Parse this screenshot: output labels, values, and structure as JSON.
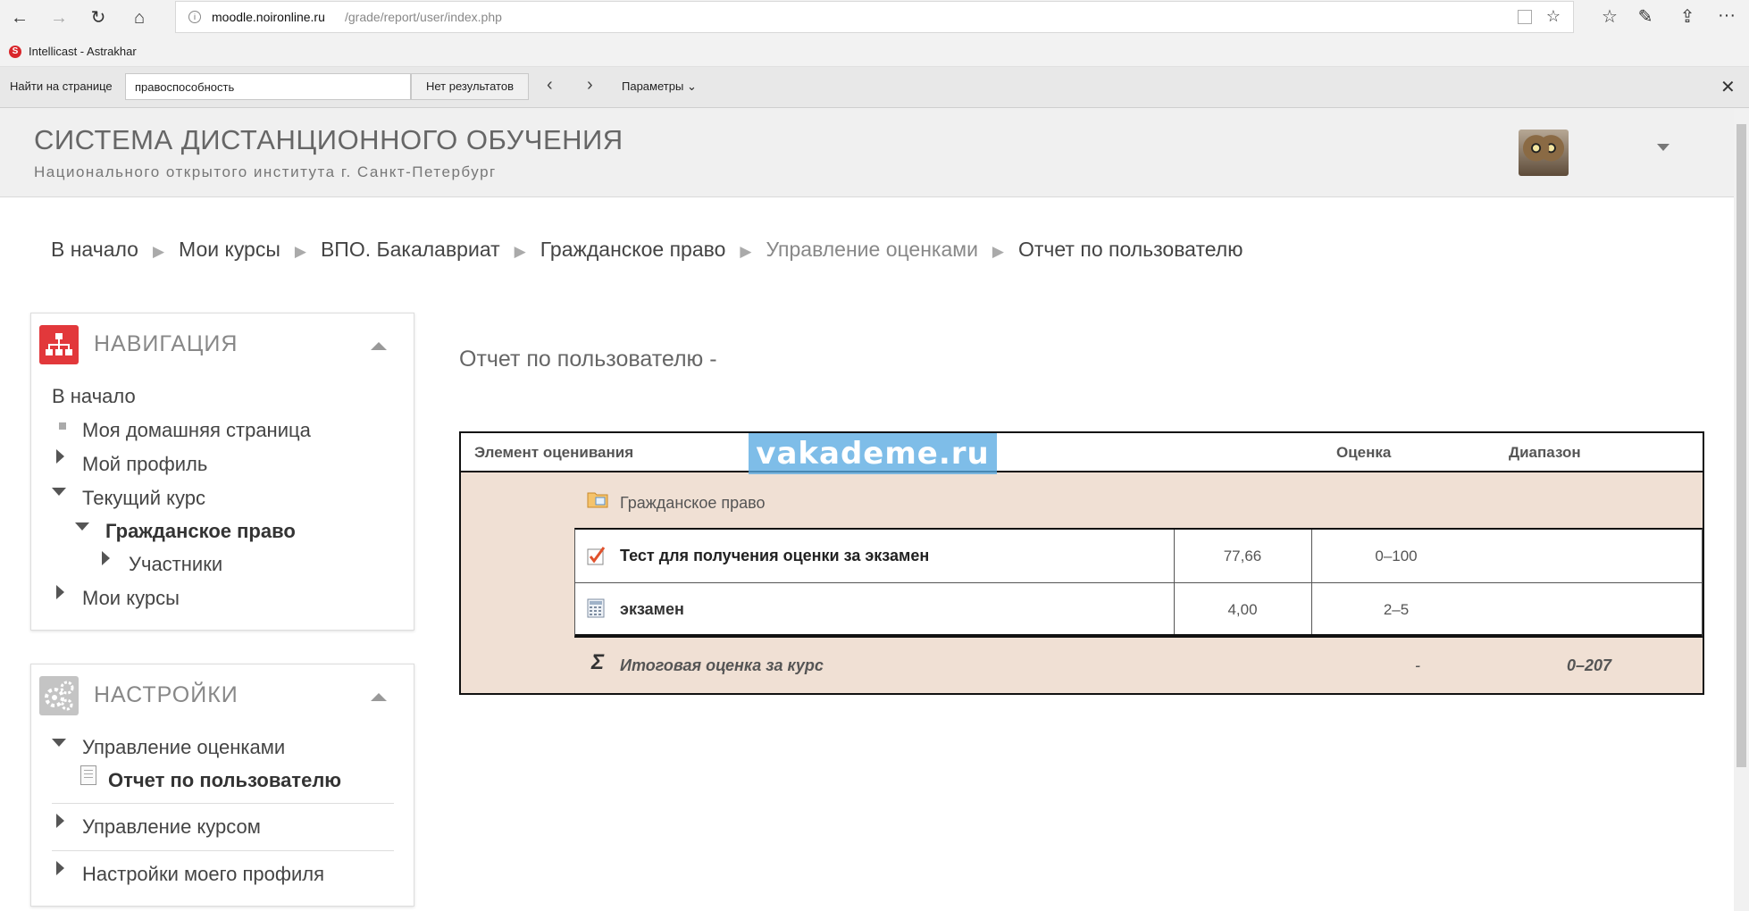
{
  "browser": {
    "url_host": "moodle.noironline.ru",
    "url_path": "/grade/report/user/index.php",
    "favorites": [
      {
        "label": "Intellicast - Astrakhar"
      }
    ],
    "find": {
      "label": "Найти на странице",
      "query": "правоспособность",
      "results": "Нет результатов",
      "options": "Параметры"
    }
  },
  "site": {
    "title": "СИСТЕМА ДИСТАНЦИОННОГО ОБУЧЕНИЯ",
    "subtitle": "Национального открытого института г. Санкт-Петербург"
  },
  "breadcrumb": [
    "В начало",
    "Мои курсы",
    "ВПО. Бакалавриат",
    "Гражданское право",
    "Управление оценками",
    "Отчет по пользователю"
  ],
  "navigation": {
    "title": "НАВИГАЦИЯ",
    "items": {
      "home": "В начало",
      "dashboard": "Моя домашняя страница",
      "profile": "Мой профиль",
      "current_course": "Текущий курс",
      "course": "Гражданское право",
      "participants": "Участники",
      "my_courses": "Мои курсы"
    }
  },
  "settings": {
    "title": "НАСТРОЙКИ",
    "items": {
      "grade_admin": "Управление оценками",
      "user_report": "Отчет по пользователю",
      "course_admin": "Управление курсом",
      "profile_settings": "Настройки моего профиля"
    }
  },
  "main": {
    "heading": "Отчет по пользователю -",
    "table": {
      "headers": {
        "item": "Элемент оценивания",
        "grade": "Оценка",
        "range": "Диапазон"
      },
      "category": "Гражданское право",
      "rows": [
        {
          "name": "Тест для получения оценки за экзамен",
          "grade": "77,66",
          "range": "0–100",
          "icon": "quiz-icon"
        },
        {
          "name": "экзамен",
          "grade": "4,00",
          "range": "2–5",
          "icon": "calculator-icon"
        }
      ],
      "total": {
        "name": "Итоговая оценка за курс",
        "grade": "-",
        "range": "0–207"
      }
    }
  },
  "watermark": "vakademe.ru",
  "colors": {
    "category_bg": "#f0e0d4",
    "nav_icon": "#e2383b",
    "watermark": "#5aaae1"
  }
}
